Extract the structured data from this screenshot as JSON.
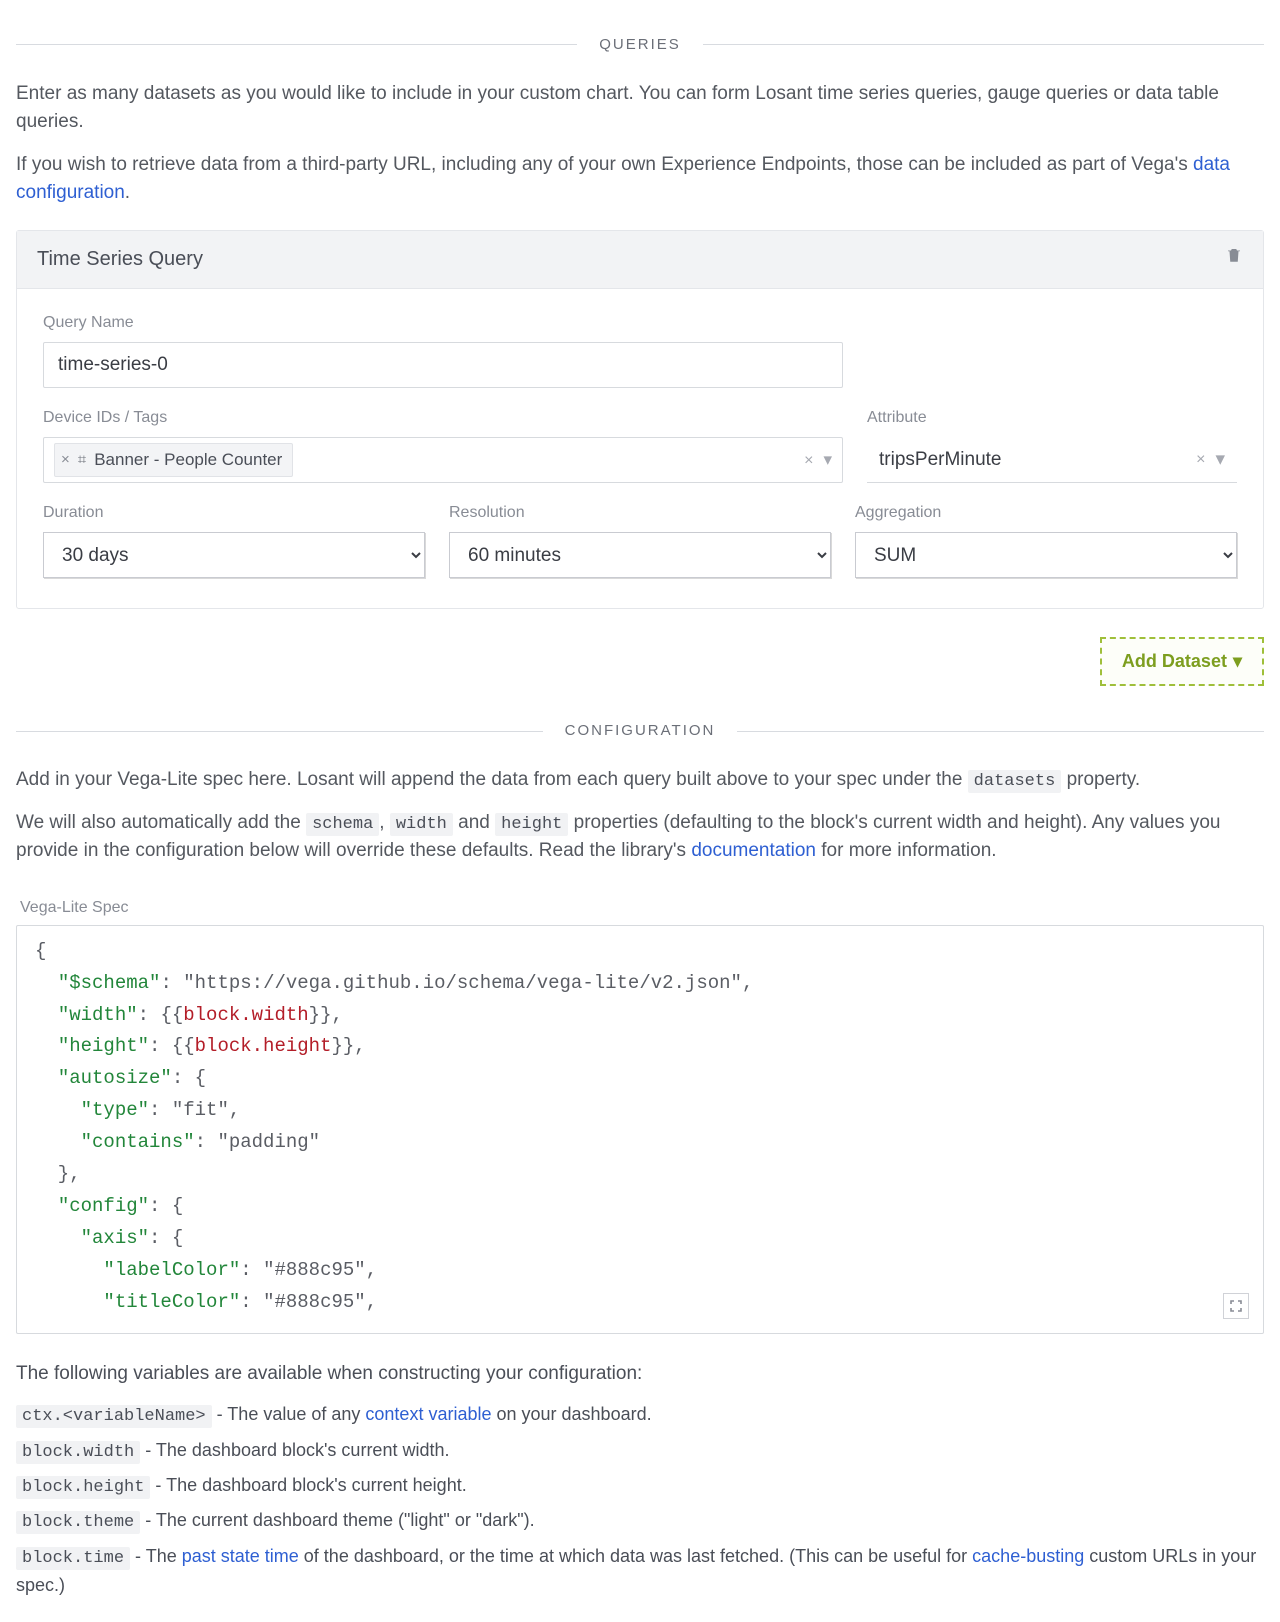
{
  "sections": {
    "queries_title": "QUERIES",
    "config_title": "CONFIGURATION"
  },
  "queries_intro": {
    "p1": "Enter as many datasets as you would like to include in your custom chart. You can form Losant time series queries, gauge queries or data table queries.",
    "p2a": "If you wish to retrieve data from a third-party URL, including any of your own Experience Endpoints, those can be included as part of Vega's ",
    "p2_link": "data configuration",
    "p2b": "."
  },
  "panel": {
    "title": "Time Series Query",
    "fields": {
      "query_name_label": "Query Name",
      "query_name_value": "time-series-0",
      "device_label": "Device IDs / Tags",
      "device_chip": "Banner - People Counter",
      "attribute_label": "Attribute",
      "attribute_value": "tripsPerMinute",
      "duration_label": "Duration",
      "duration_value": "30 days",
      "resolution_label": "Resolution",
      "resolution_value": "60 minutes",
      "aggregation_label": "Aggregation",
      "aggregation_value": "SUM"
    }
  },
  "add_dataset_label": "Add Dataset",
  "config_intro": {
    "p1a": "Add in your Vega-Lite spec here. Losant will append the data from each query built above to your spec under the ",
    "p1_code": "datasets",
    "p1b": " property.",
    "p2a": "We will also automatically add the ",
    "p2_code1": "schema",
    "p2_mid1": ", ",
    "p2_code2": "width",
    "p2_mid2": " and ",
    "p2_code3": "height",
    "p2b": " properties (defaulting to the block's current width and height). Any values you provide in the configuration below will override these defaults. Read the library's ",
    "p2_link": "documentation",
    "p2c": " for more information."
  },
  "spec": {
    "label": "Vega-Lite Spec",
    "code_lines": [
      {
        "segs": [
          {
            "t": "{",
            "c": "punc"
          }
        ]
      },
      {
        "segs": [
          {
            "t": "  ",
            "c": ""
          },
          {
            "t": "\"$schema\"",
            "c": "key"
          },
          {
            "t": ": ",
            "c": "punc"
          },
          {
            "t": "\"https://vega.github.io/schema/vega-lite/v2.json\"",
            "c": "str"
          },
          {
            "t": ",",
            "c": "punc"
          }
        ]
      },
      {
        "segs": [
          {
            "t": "  ",
            "c": ""
          },
          {
            "t": "\"width\"",
            "c": "key"
          },
          {
            "t": ": {{",
            "c": "punc"
          },
          {
            "t": "block.width",
            "c": "tmpl"
          },
          {
            "t": "}},",
            "c": "punc"
          }
        ]
      },
      {
        "segs": [
          {
            "t": "  ",
            "c": ""
          },
          {
            "t": "\"height\"",
            "c": "key"
          },
          {
            "t": ": {{",
            "c": "punc"
          },
          {
            "t": "block.height",
            "c": "tmpl"
          },
          {
            "t": "}},",
            "c": "punc"
          }
        ]
      },
      {
        "segs": [
          {
            "t": "  ",
            "c": ""
          },
          {
            "t": "\"autosize\"",
            "c": "key"
          },
          {
            "t": ": {",
            "c": "punc"
          }
        ]
      },
      {
        "segs": [
          {
            "t": "    ",
            "c": ""
          },
          {
            "t": "\"type\"",
            "c": "key"
          },
          {
            "t": ": ",
            "c": "punc"
          },
          {
            "t": "\"fit\"",
            "c": "str"
          },
          {
            "t": ",",
            "c": "punc"
          }
        ]
      },
      {
        "segs": [
          {
            "t": "    ",
            "c": ""
          },
          {
            "t": "\"contains\"",
            "c": "key"
          },
          {
            "t": ": ",
            "c": "punc"
          },
          {
            "t": "\"padding\"",
            "c": "str"
          }
        ]
      },
      {
        "segs": [
          {
            "t": "  },",
            "c": "punc"
          }
        ]
      },
      {
        "segs": [
          {
            "t": "  ",
            "c": ""
          },
          {
            "t": "\"config\"",
            "c": "key"
          },
          {
            "t": ": {",
            "c": "punc"
          }
        ]
      },
      {
        "segs": [
          {
            "t": "    ",
            "c": ""
          },
          {
            "t": "\"axis\"",
            "c": "key"
          },
          {
            "t": ": {",
            "c": "punc"
          }
        ]
      },
      {
        "segs": [
          {
            "t": "      ",
            "c": ""
          },
          {
            "t": "\"labelColor\"",
            "c": "key"
          },
          {
            "t": ": ",
            "c": "punc"
          },
          {
            "t": "\"#888c95\"",
            "c": "str"
          },
          {
            "t": ",",
            "c": "punc"
          }
        ]
      },
      {
        "segs": [
          {
            "t": "      ",
            "c": ""
          },
          {
            "t": "\"titleColor\"",
            "c": "key"
          },
          {
            "t": ": ",
            "c": "punc"
          },
          {
            "t": "\"#888c95\"",
            "c": "str"
          },
          {
            "t": ",",
            "c": "punc"
          }
        ]
      }
    ]
  },
  "vars": {
    "intro": "The following variables are available when constructing your configuration:",
    "items": [
      {
        "code": "ctx.<variableName>",
        "pre": " - The value of any ",
        "link": "context variable",
        "post": " on your dashboard."
      },
      {
        "code": "block.width",
        "pre": " - The dashboard block's current width.",
        "link": "",
        "post": ""
      },
      {
        "code": "block.height",
        "pre": " - The dashboard block's current height.",
        "link": "",
        "post": ""
      },
      {
        "code": "block.theme",
        "pre": " - The current dashboard theme (\"light\" or \"dark\").",
        "link": "",
        "post": ""
      },
      {
        "code": "block.time",
        "pre": " - The ",
        "link": "past state time",
        "post": " of the dashboard, or the time at which data was last fetched. (This can be useful for ",
        "link2": "cache-busting",
        "post2": " custom URLs in your spec.)"
      }
    ]
  }
}
